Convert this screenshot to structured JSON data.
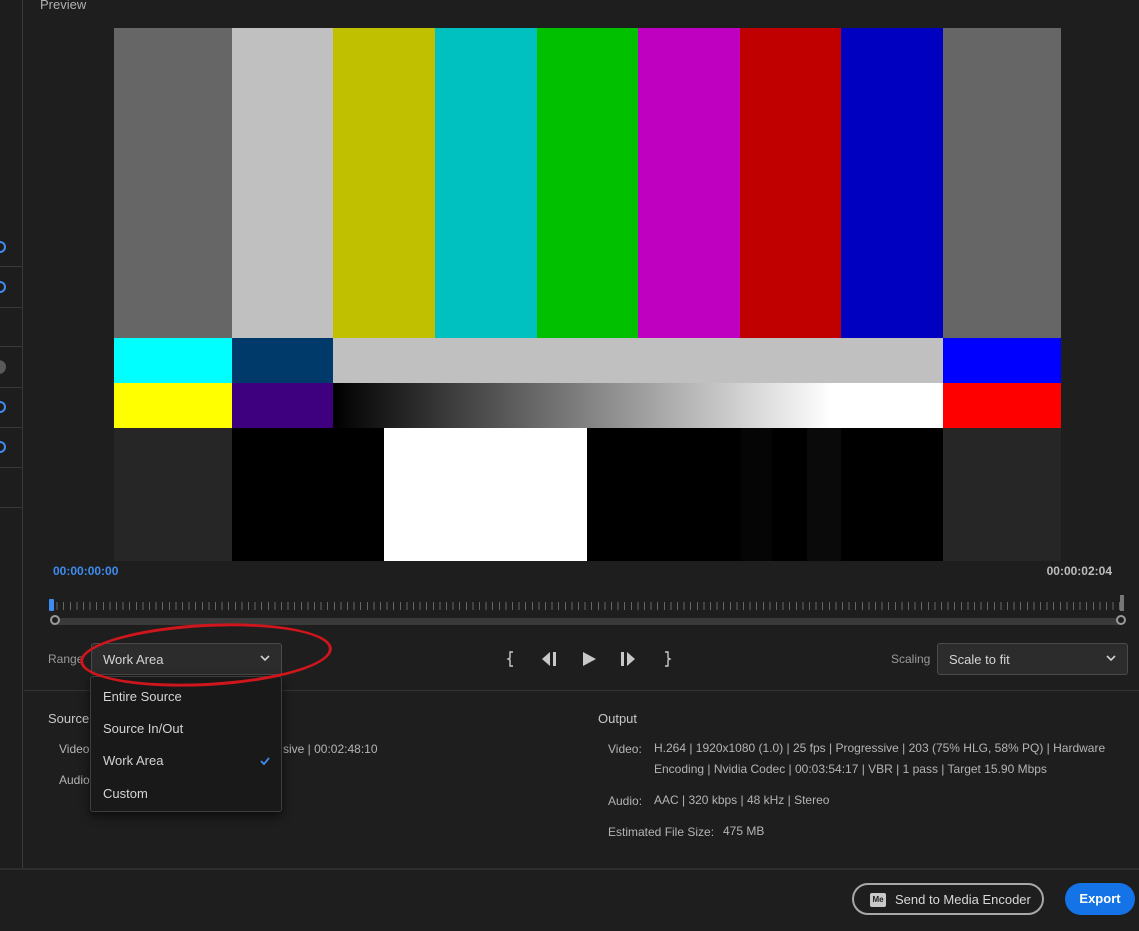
{
  "preview": {
    "title": "Preview",
    "timecode_start": "00:00:00:00",
    "timecode_end": "00:00:02:04"
  },
  "range": {
    "label": "Range",
    "selected": "Work Area",
    "options": [
      "Entire Source",
      "Source In/Out",
      "Work Area",
      "Custom"
    ]
  },
  "scaling": {
    "label": "Scaling",
    "selected": "Scale to fit"
  },
  "source": {
    "title": "Source",
    "video_label": "Video",
    "video_value_visible": "sive  |  00:02:48:10",
    "audio_label": "Audio"
  },
  "output": {
    "title": "Output",
    "video_label": "Video:",
    "video_line1": "H.264  |  1920x1080 (1.0)  |  25 fps  |  Progressive  |  203 (75% HLG, 58% PQ)  |  Hardware",
    "video_line2": "Encoding  |  Nvidia Codec  |  00:03:54:17  |  VBR  |  1 pass  |  Target 15.90 Mbps",
    "audio_label": "Audio:",
    "audio_value": "AAC  |  320 kbps  |  48 kHz  |  Stereo",
    "size_label": "Estimated File Size:",
    "size_value": "475 MB"
  },
  "footer": {
    "send_button": "Send to Media Encoder",
    "send_icon_text": "Me",
    "export_button": "Export"
  },
  "colors": {
    "accent": "#1473e6",
    "timecode_blue": "#3f8cf0",
    "annotation_red": "#d0161c",
    "bars": {
      "gray": "#666666",
      "white": "#c0c0c0",
      "yellow": "#c0c000",
      "cyan": "#00c0c0",
      "green": "#00c000",
      "magenta": "#c000c0",
      "red": "#c00000",
      "blue": "#0000c0"
    }
  }
}
